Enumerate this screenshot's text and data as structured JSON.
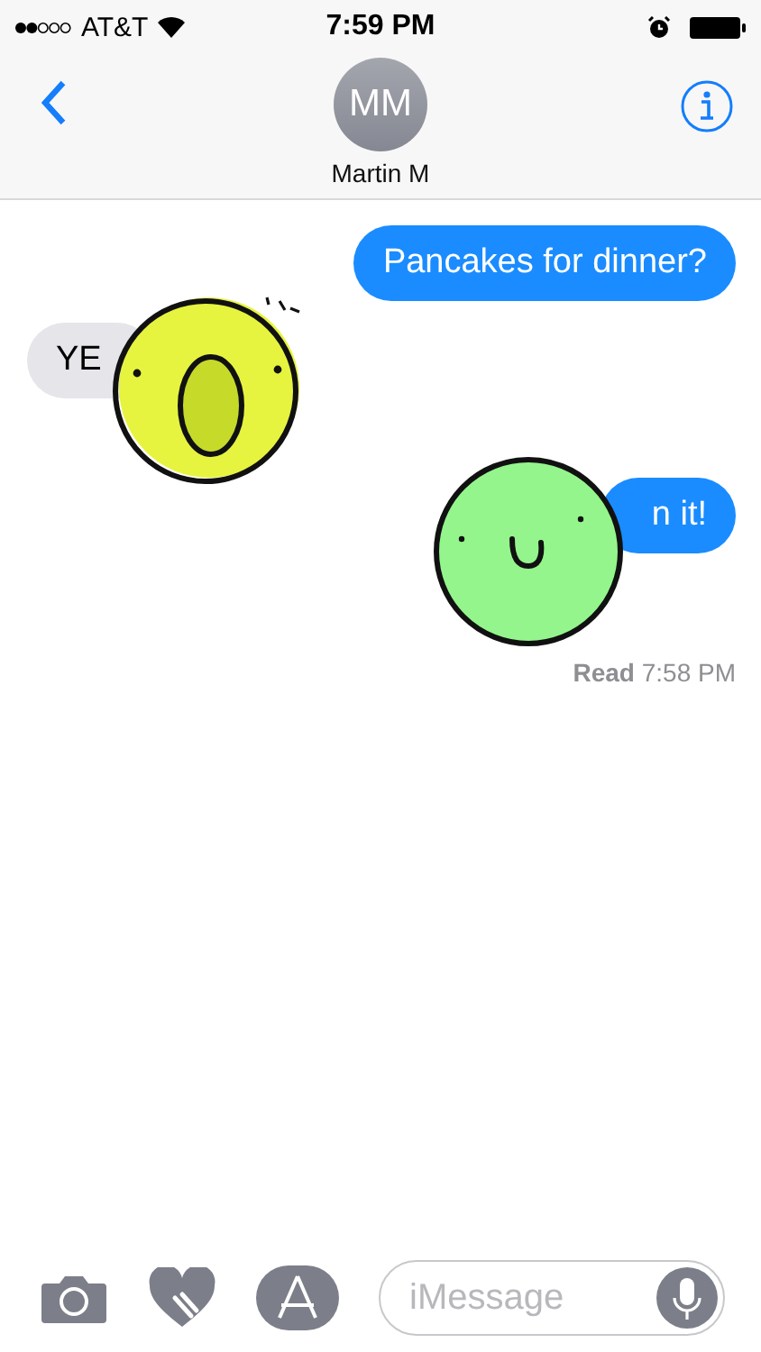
{
  "status_bar": {
    "carrier": "AT&T",
    "time": "7:59 PM"
  },
  "header": {
    "avatar_initials": "MM",
    "contact_name": "Martin M"
  },
  "messages": [
    {
      "kind": "outgoing",
      "text": "Pancakes for dinner?"
    },
    {
      "kind": "incoming",
      "text": "YE",
      "sticker": {
        "kind": "surprised"
      }
    },
    {
      "kind": "outgoing",
      "text": "n it!",
      "sticker": {
        "kind": "smile"
      }
    }
  ],
  "receipt": {
    "label": "Read",
    "time": "7:58 PM"
  },
  "composer": {
    "placeholder": "iMessage"
  }
}
